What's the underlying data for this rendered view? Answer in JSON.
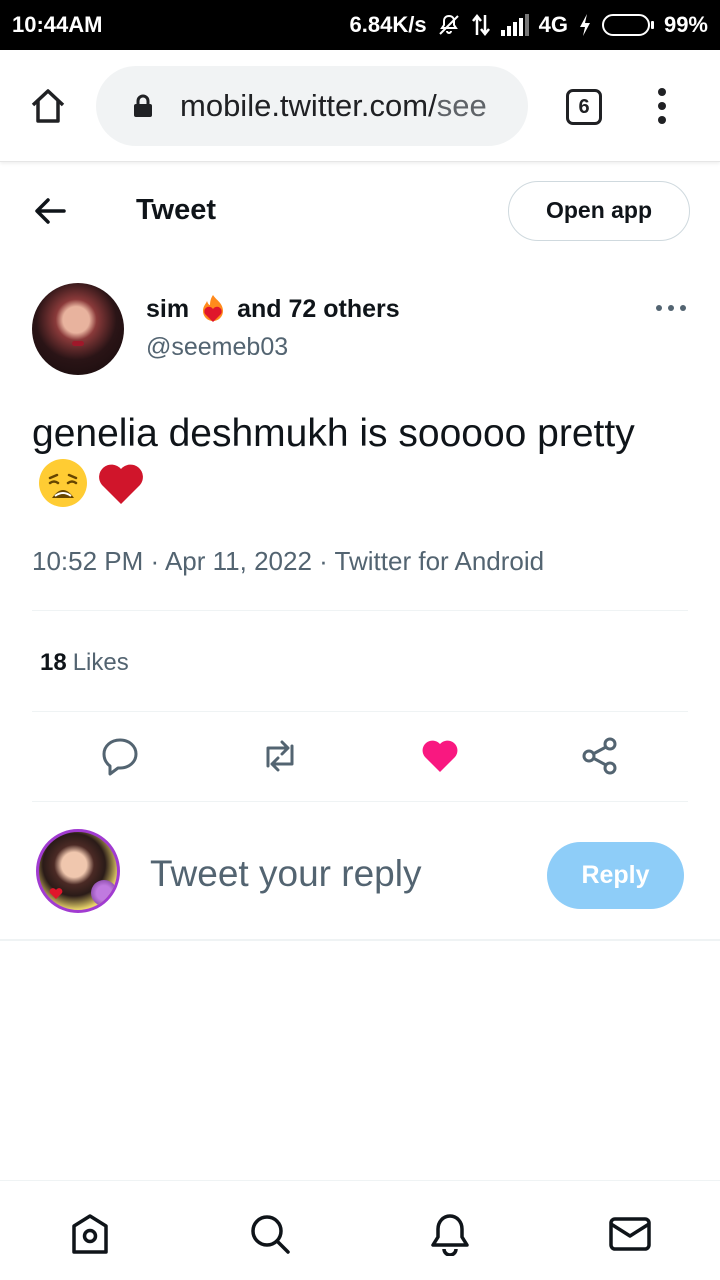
{
  "status_bar": {
    "time": "10:44AM",
    "net_speed": "6.84K/s",
    "network": "4G",
    "battery": "99%",
    "battery_level": 0.99,
    "icons": [
      "mute-icon",
      "data-arrows-icon",
      "signal-icon",
      "charging-icon",
      "battery-icon"
    ]
  },
  "browser": {
    "url_host": "mobile.twitter.com/",
    "url_rest": "see",
    "tab_count": "6"
  },
  "header": {
    "title": "Tweet",
    "open_app_label": "Open app"
  },
  "tweet": {
    "author_name": "sim",
    "author_suffix": "and 72 others",
    "author_handle": "@seemeb03",
    "text": "genelia deshmukh is sooooo pretty",
    "meta": "10:52 PM · Apr 11, 2022 · Twitter for Android",
    "like_count": "18",
    "like_label": "Likes",
    "emoji": [
      "weary-face",
      "red-heart"
    ]
  },
  "actions": {
    "icons": [
      "reply-icon",
      "retweet-icon",
      "like-icon",
      "share-icon"
    ],
    "liked_color": "#f91880",
    "icon_color": "#536471"
  },
  "reply": {
    "placeholder": "Tweet your reply",
    "button_label": "Reply",
    "button_color": "#8ecdf8"
  },
  "bottom_nav": {
    "items": [
      "home-icon",
      "search-icon",
      "notifications-icon",
      "messages-icon"
    ]
  }
}
